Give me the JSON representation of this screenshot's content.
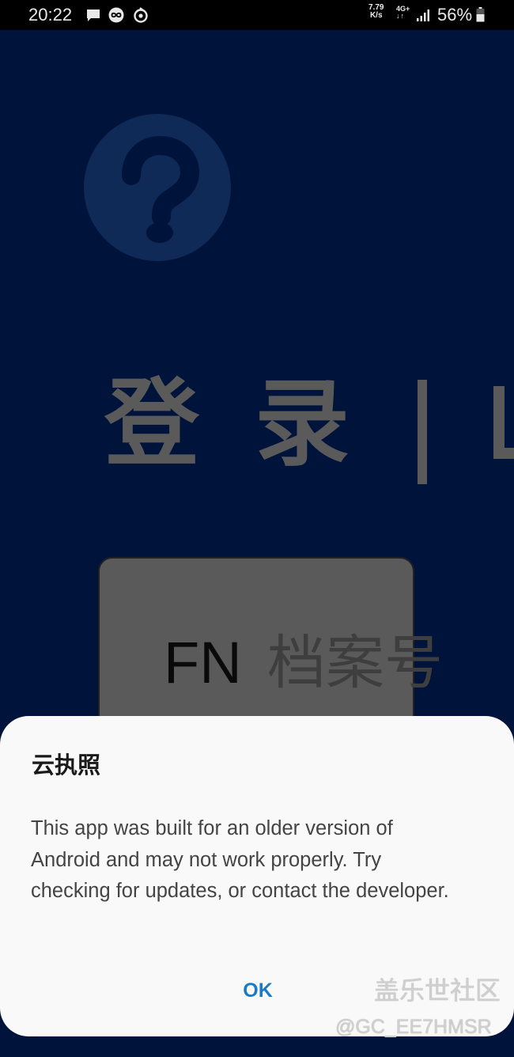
{
  "status_bar": {
    "time": "20:22",
    "icons": [
      "message-icon",
      "infinity-app-icon",
      "netease-icon"
    ],
    "network_speed_value": "7.79",
    "network_speed_unit": "K/s",
    "network_type": "4G+",
    "battery_percent": "56%"
  },
  "background_app": {
    "help_icon": "question-mark-icon",
    "login_title": "登录",
    "login_title_second": "录",
    "login_title_first": "登",
    "card_label_latin": "FN",
    "card_label_chinese": "档案号"
  },
  "dialog": {
    "title": "云执照",
    "message": "This app was built for an older version of Android and may not work properly. Try checking for updates, or contact the developer.",
    "ok_label": "OK",
    "accent_color": "#1a7bc4"
  },
  "watermark": {
    "name": "盖乐世社区",
    "handle": "@GC_EE7HMSR"
  }
}
